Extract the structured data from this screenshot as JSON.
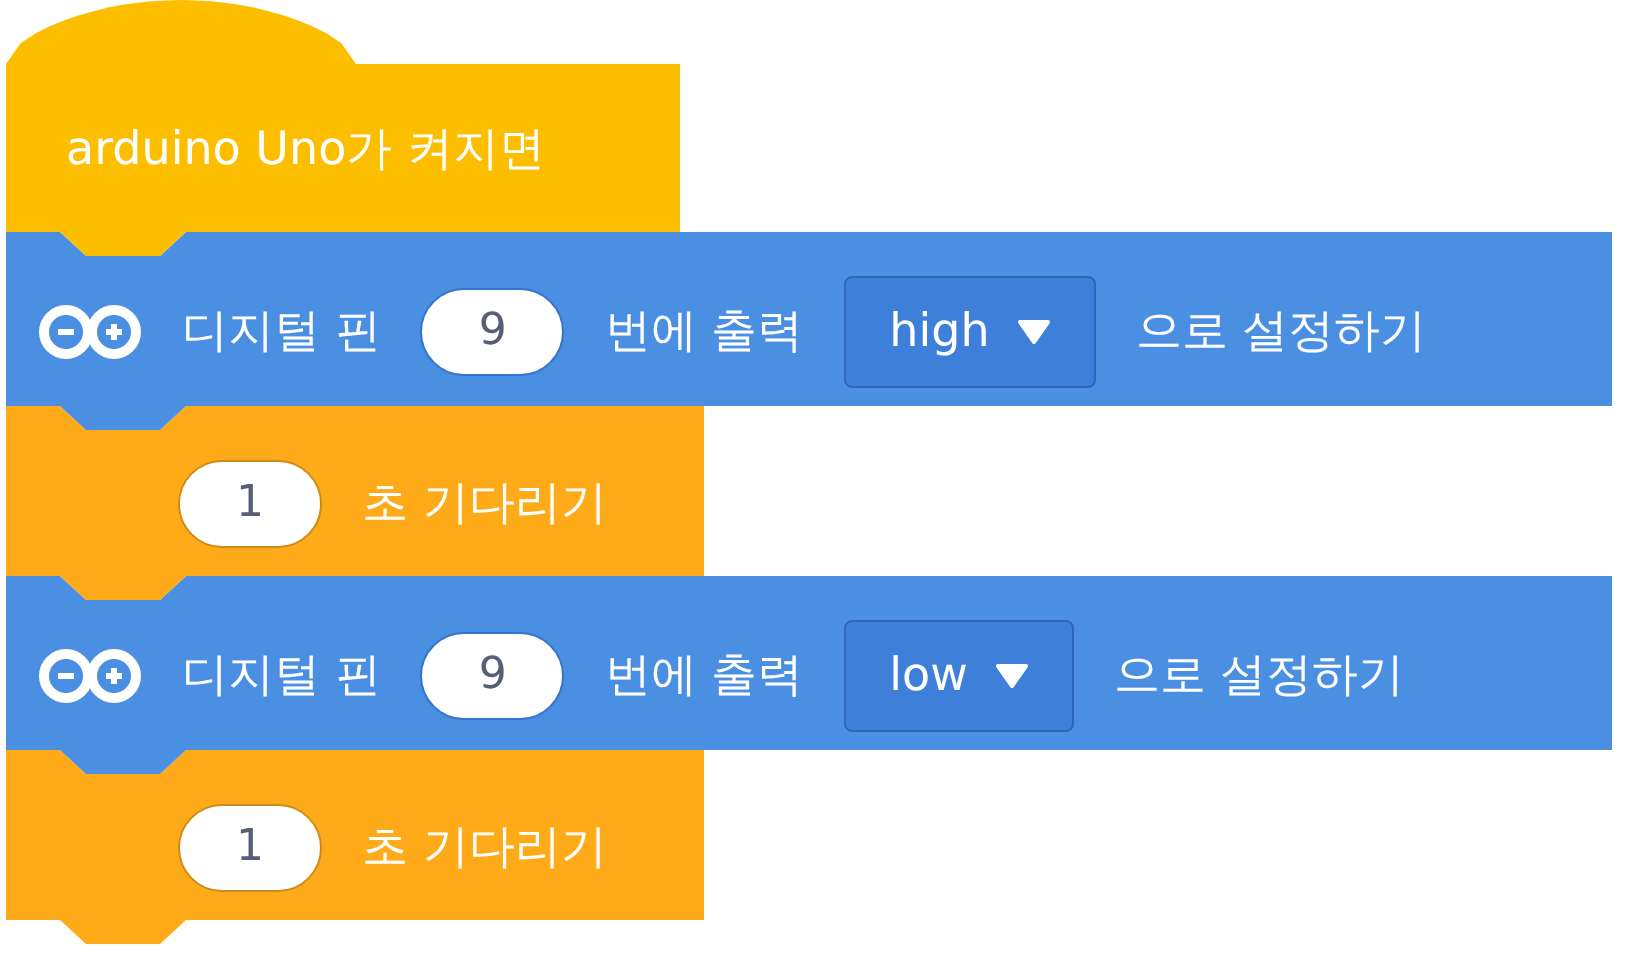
{
  "hat_block": {
    "label": "arduino Uno가 켜지면"
  },
  "blocks": [
    {
      "kind": "digital_write",
      "label": "디지털 핀",
      "pin": "9",
      "middle": "번에 출력",
      "value": "high",
      "suffix": "으로 설정하기"
    },
    {
      "kind": "wait",
      "seconds": "1",
      "label": "초 기다리기"
    },
    {
      "kind": "digital_write",
      "label": "디지털 핀",
      "pin": "9",
      "middle": "번에 출력",
      "value": "low",
      "suffix": "으로 설정하기"
    },
    {
      "kind": "wait",
      "seconds": "1",
      "label": "초 기다리기"
    }
  ]
}
